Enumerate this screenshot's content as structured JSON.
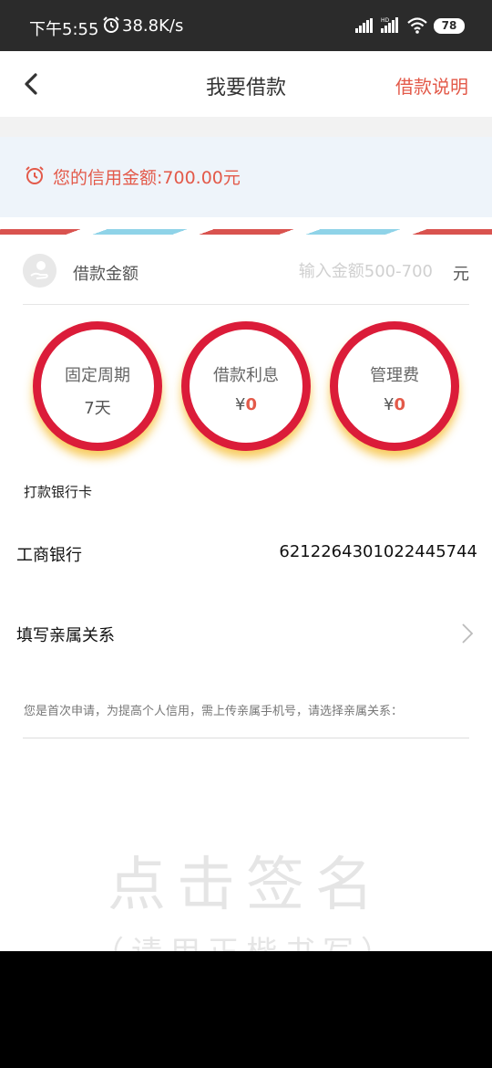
{
  "status_bar": {
    "time": "下午5:55",
    "speed": "38.8K/s",
    "battery": "78"
  },
  "nav": {
    "title": "我要借款",
    "help_link": "借款说明"
  },
  "credit": {
    "text": "您的信用金额:700.00元",
    "accent_color": "#e35a4a"
  },
  "amount": {
    "label": "借款金额",
    "placeholder": "输入金额500-700",
    "unit": "元"
  },
  "circles": [
    {
      "label": "固定周期",
      "prefix": "",
      "value": "7天"
    },
    {
      "label": "借款利息",
      "prefix": "¥",
      "value": "0"
    },
    {
      "label": "管理费",
      "prefix": "¥",
      "value": "0"
    }
  ],
  "bank": {
    "section_title": "打款银行卡",
    "name": "工商银行",
    "card_number": "6212264301022445744"
  },
  "relation": {
    "label": "填写亲属关系",
    "hint": "您是首次申请，为提高个人信用，需上传亲属手机号，请选择亲属关系："
  },
  "signature": {
    "title": "点击签名",
    "subtitle": "（请用正楷书写）"
  }
}
